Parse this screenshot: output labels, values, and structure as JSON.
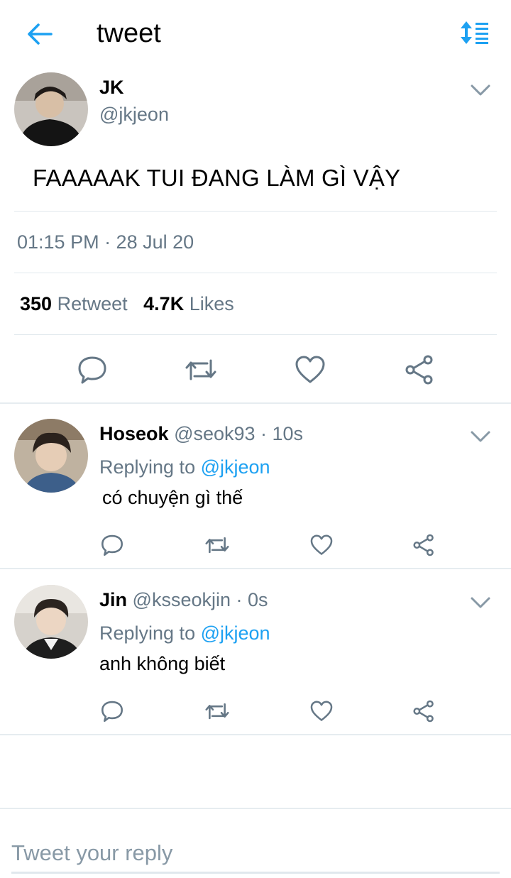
{
  "header": {
    "title": "tweet",
    "back_icon": "back-arrow-icon",
    "sort_icon": "sort-icon",
    "accent": "#1da1f2"
  },
  "tweet": {
    "author_name": "JK",
    "author_handle": "@jkjeon",
    "text": "FAAAAAK TUI ĐANG LÀM GÌ VẬY",
    "time": "01:15 PM · 28 Jul 20",
    "retweet_count": "350",
    "retweet_label": "Retweet",
    "like_count": "4.7K",
    "like_label": "Likes"
  },
  "replies": [
    {
      "name": "Hoseok",
      "handle": "@seok93 · 10s",
      "replying_prefix": "Replying to",
      "replying_to": "@jkjeon",
      "text": "có chuyện gì thế"
    },
    {
      "name": "Jin",
      "handle": "@ksseokjin · 0s",
      "replying_prefix": "Replying to",
      "replying_to": "@jkjeon",
      "text": "anh không biết"
    }
  ],
  "composer": {
    "placeholder": "Tweet your reply"
  },
  "colors": {
    "muted": "#657786",
    "icon": "#657786",
    "divider": "#e1e8ed"
  }
}
